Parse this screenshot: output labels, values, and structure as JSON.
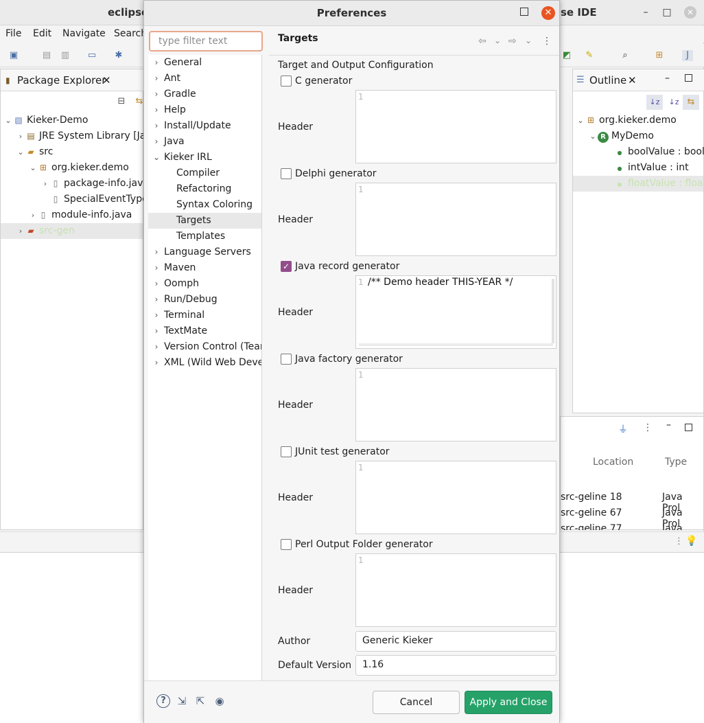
{
  "ide": {
    "title_left": "eclipse-",
    "title_right": "se IDE",
    "menu": [
      "File",
      "Edit",
      "Navigate",
      "Search"
    ],
    "package_explorer": {
      "tab_label": "Package Explorer",
      "tree": [
        {
          "label": "Kieker-Demo",
          "icon": "project-icon"
        },
        {
          "label": "JRE System Library [Jav",
          "icon": "library-icon"
        },
        {
          "label": "src",
          "icon": "source-folder-icon"
        },
        {
          "label": "org.kieker.demo",
          "icon": "package-icon"
        },
        {
          "label": "package-info.java",
          "icon": "java-file-icon"
        },
        {
          "label": "SpecialEventType",
          "icon": "file-icon"
        },
        {
          "label": "module-info.java",
          "icon": "java-file-icon"
        },
        {
          "label": "src-gen",
          "icon": "source-folder-icon"
        }
      ]
    },
    "outline": {
      "tab_label": "Outline",
      "tree": [
        {
          "label": "org.kieker.demo"
        },
        {
          "label": "MyDemo"
        },
        {
          "label": "boolValue : boole"
        },
        {
          "label": "intValue : int"
        },
        {
          "label": "floatValue : float"
        }
      ]
    },
    "problems": {
      "columns": [
        "Location",
        "Type"
      ],
      "rows": [
        {
          "folder": "src-ge",
          "location": "line 18",
          "type": "Java Prol"
        },
        {
          "folder": "src-ge",
          "location": "line 67",
          "type": "Java Prol"
        },
        {
          "folder": "src-ge",
          "location": "line 77",
          "type": "Java Prol"
        }
      ]
    }
  },
  "dialog": {
    "title": "Preferences",
    "filter_placeholder": "type filter text",
    "nav": [
      {
        "label": "General",
        "expandable": true,
        "level": 0
      },
      {
        "label": "Ant",
        "expandable": true,
        "level": 0
      },
      {
        "label": "Gradle",
        "expandable": true,
        "level": 0
      },
      {
        "label": "Help",
        "expandable": true,
        "level": 0
      },
      {
        "label": "Install/Update",
        "expandable": true,
        "level": 0
      },
      {
        "label": "Java",
        "expandable": true,
        "level": 0
      },
      {
        "label": "Kieker IRL",
        "expandable": true,
        "expanded": true,
        "level": 0
      },
      {
        "label": "Compiler",
        "level": 1
      },
      {
        "label": "Refactoring",
        "level": 1
      },
      {
        "label": "Syntax Coloring",
        "level": 1
      },
      {
        "label": "Targets",
        "level": 1,
        "selected": true
      },
      {
        "label": "Templates",
        "level": 1
      },
      {
        "label": "Language Servers",
        "expandable": true,
        "level": 0
      },
      {
        "label": "Maven",
        "expandable": true,
        "level": 0
      },
      {
        "label": "Oomph",
        "expandable": true,
        "level": 0
      },
      {
        "label": "Run/Debug",
        "expandable": true,
        "level": 0
      },
      {
        "label": "Terminal",
        "expandable": true,
        "level": 0
      },
      {
        "label": "TextMate",
        "expandable": true,
        "level": 0
      },
      {
        "label": "Version Control (Team",
        "expandable": true,
        "level": 0
      },
      {
        "label": "XML (Wild Web Develo",
        "expandable": true,
        "level": 0
      }
    ],
    "page_title": "Targets",
    "section_label": "Target and Output Configuration",
    "header_label": "Header",
    "generators": [
      {
        "label": "C generator",
        "checked": false,
        "line_no": "1",
        "text": ""
      },
      {
        "label": "Delphi generator",
        "checked": false,
        "line_no": "1",
        "text": ""
      },
      {
        "label": "Java record generator",
        "checked": true,
        "line_no": "1",
        "text": "/** Demo header THIS-YEAR */"
      },
      {
        "label": "Java factory generator",
        "checked": false,
        "line_no": "1",
        "text": ""
      },
      {
        "label": "JUnit test generator",
        "checked": false,
        "line_no": "1",
        "text": ""
      },
      {
        "label": "Perl Output Folder generator",
        "checked": false,
        "line_no": "1",
        "text": ""
      }
    ],
    "author_label": "Author",
    "author_value": "Generic Kieker",
    "version_label": "Default Version",
    "version_value": "1.16",
    "cancel_label": "Cancel",
    "apply_label": "Apply and Close",
    "colors": {
      "accent": "#924d8b",
      "apply": "#26a269",
      "close": "#e95420"
    }
  }
}
